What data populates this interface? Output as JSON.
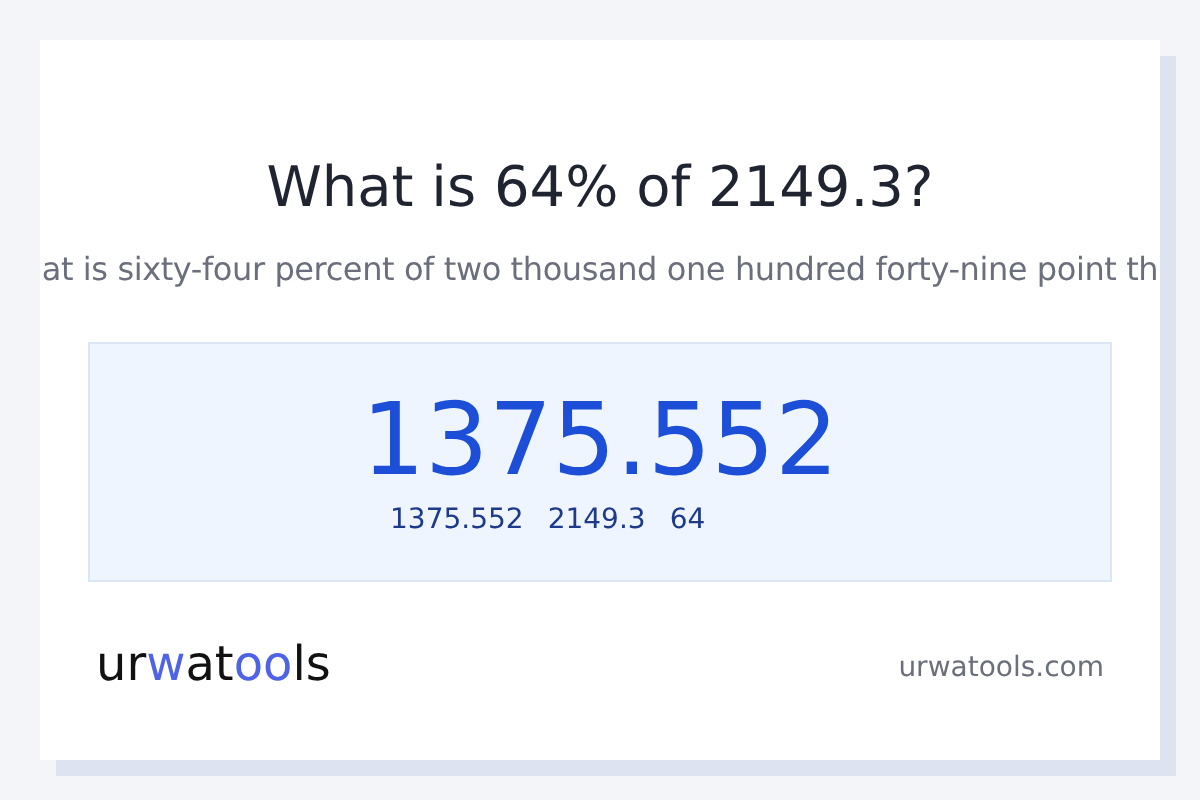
{
  "title": "What is 64% of 2149.3?",
  "subtitle": "at is sixty-four percent of two thousand one hundred forty-nine point th",
  "result": {
    "value": "1375.552",
    "details": [
      "1375.552",
      "2149.3",
      "64"
    ]
  },
  "logo": [
    {
      "text": "ur",
      "accent": false
    },
    {
      "text": "w",
      "accent": true
    },
    {
      "text": "at",
      "accent": false
    },
    {
      "text": "oo",
      "accent": true
    },
    {
      "text": "ls",
      "accent": false
    }
  ],
  "site": "urwatools.com"
}
